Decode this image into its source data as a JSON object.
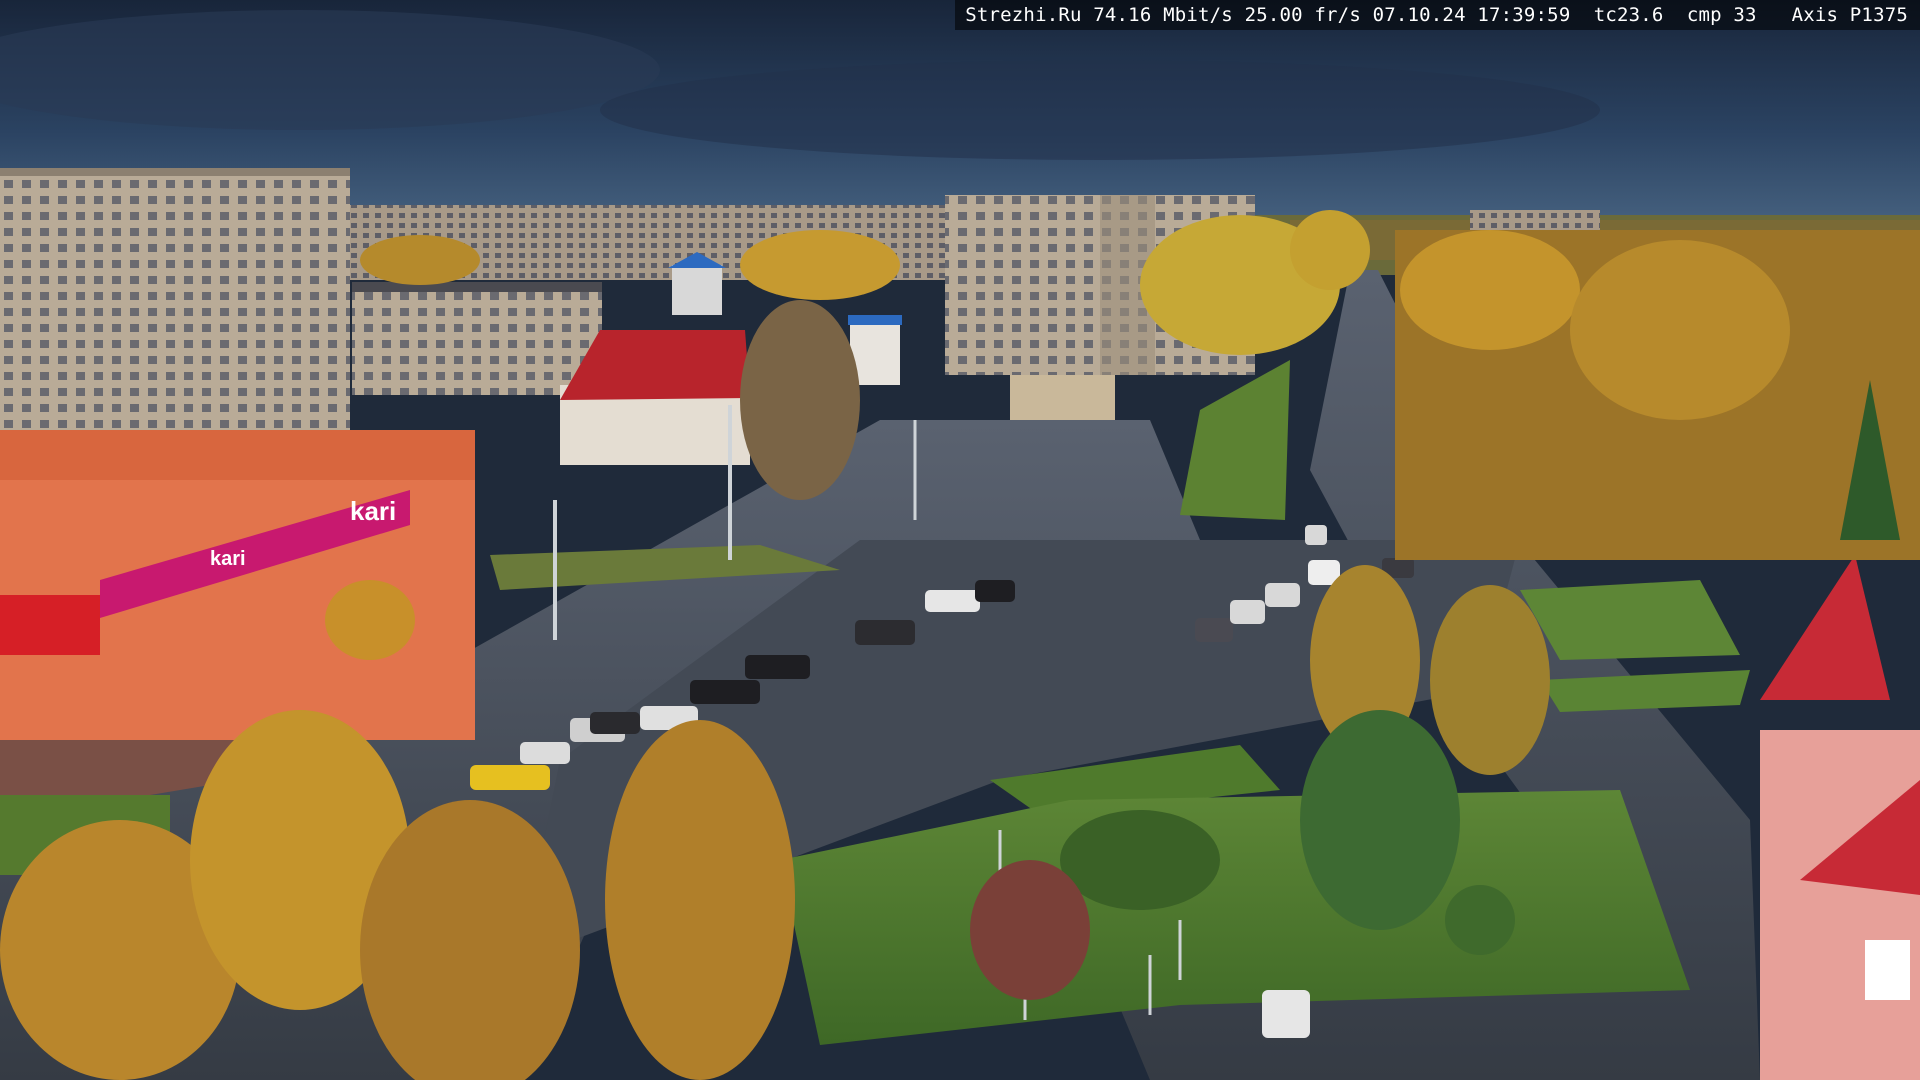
{
  "overlay": {
    "text": "Strezhi.Ru 74.16 Mbit/s 25.00 fr/s 07.10.24 17:39:59  tc23.6  cmp 33   Axis P1375"
  },
  "signs": {
    "store_main": "kari",
    "store_banner": "kari"
  },
  "colors": {
    "sky_top": "#1d2c44",
    "sky_horizon": "#3c5878",
    "road": "#3f4650",
    "grass": "#4e7a2e",
    "foliage_yellow": "#c4942c",
    "kari_magenta": "#c8196f",
    "storefront_orange": "#e2744c",
    "roof_red": "#b8242c"
  }
}
